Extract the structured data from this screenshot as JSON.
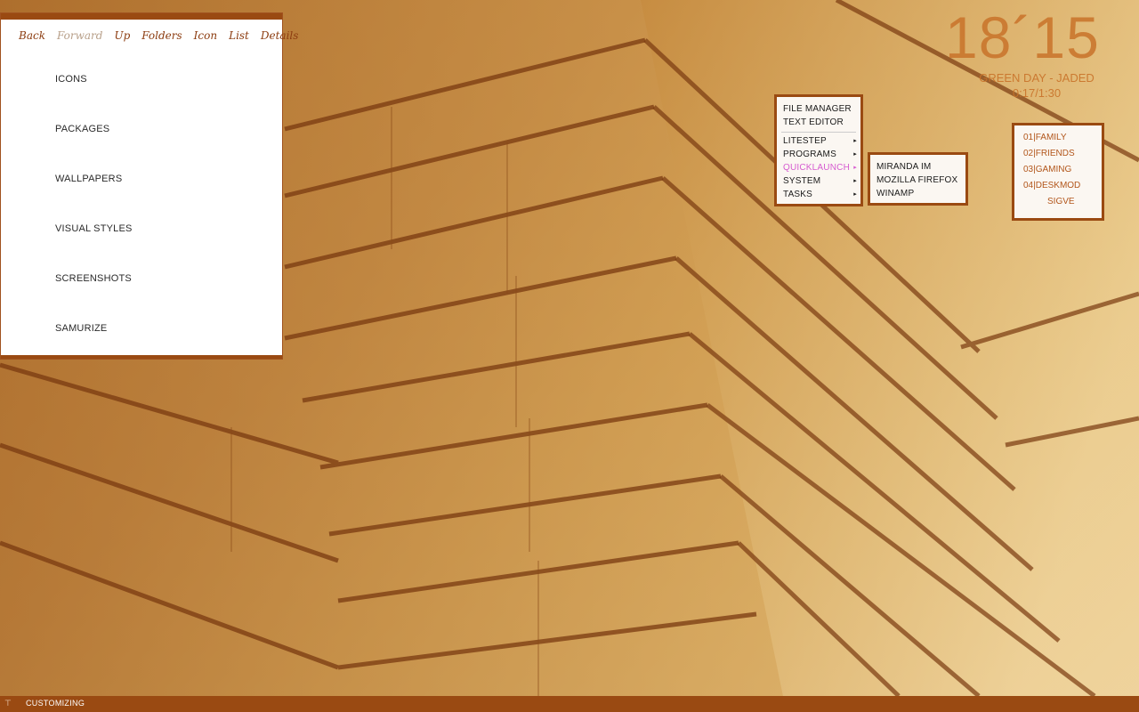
{
  "explorer": {
    "toolbar": [
      "Back",
      "Forward",
      "Up",
      "Folders",
      "Icon",
      "List",
      "Details"
    ],
    "folders": [
      "ICONS",
      "PACKAGES",
      "WALLPAPERS",
      "VISUAL STYLES",
      "SCREENSHOTS",
      "SAMURIZE"
    ]
  },
  "clock": {
    "time": "18´15",
    "track": "GREEN DAY - JADED",
    "position": "0:17/1:30"
  },
  "main_menu": {
    "items_top": [
      "FILE MANAGER",
      "TEXT EDITOR"
    ],
    "items_sub": [
      "LITESTEP",
      "PROGRAMS",
      "QUICKLAUNCH",
      "SYSTEM",
      "TASKS"
    ],
    "active": "QUICKLAUNCH",
    "arrow_glyph": "▸"
  },
  "quicklaunch_menu": {
    "items": [
      "MIRANDA IM",
      "MOZILLA FIREFOX",
      "WINAMP"
    ]
  },
  "groups": {
    "items": [
      "01|FAMILY",
      "02|FRIENDS",
      "03|GAMING",
      "04|DESKMOD"
    ],
    "sub": "SIGVE"
  },
  "taskbar": {
    "start_glyph": "⊤",
    "task_label": "CUSTOMIZING"
  },
  "colors": {
    "accent": "#9a4a12",
    "clock_text": "#c9732a",
    "menu_active": "#d65bd0",
    "group_text": "#b2561b"
  }
}
